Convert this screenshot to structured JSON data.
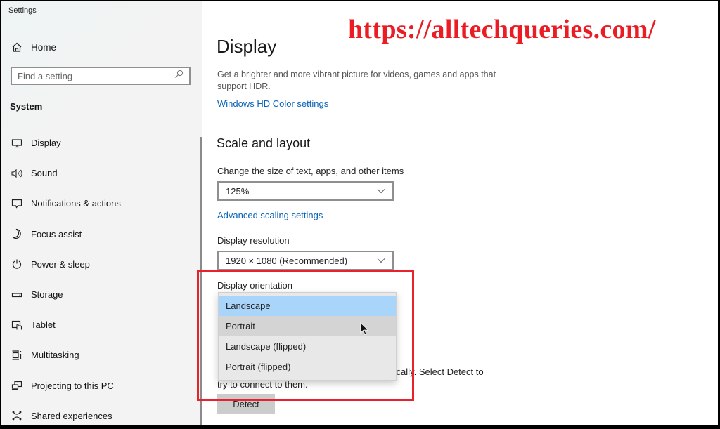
{
  "window": {
    "title": "Settings"
  },
  "sidebar": {
    "home_label": "Home",
    "search_placeholder": "Find a setting",
    "section_label": "System",
    "items": [
      {
        "label": "Display",
        "icon": "monitor-icon"
      },
      {
        "label": "Sound",
        "icon": "speaker-icon"
      },
      {
        "label": "Notifications & actions",
        "icon": "notification-icon"
      },
      {
        "label": "Focus assist",
        "icon": "moon-icon"
      },
      {
        "label": "Power & sleep",
        "icon": "power-icon"
      },
      {
        "label": "Storage",
        "icon": "storage-icon"
      },
      {
        "label": "Tablet",
        "icon": "tablet-icon"
      },
      {
        "label": "Multitasking",
        "icon": "multitasking-icon"
      },
      {
        "label": "Projecting to this PC",
        "icon": "projecting-icon"
      },
      {
        "label": "Shared experiences",
        "icon": "shared-experiences-icon"
      }
    ]
  },
  "main": {
    "title": "Display",
    "hdr_description": "Get a brighter and more vibrant picture for videos, games and apps that support HDR.",
    "hdr_link": "Windows HD Color settings",
    "scale_section_title": "Scale and layout",
    "scale_label": "Change the size of text, apps, and other items",
    "scale_value": "125%",
    "advanced_scaling_link": "Advanced scaling settings",
    "resolution_label": "Display resolution",
    "resolution_value": "1920 × 1080 (Recommended)",
    "orientation_label": "Display orientation",
    "orientation_options": [
      "Landscape",
      "Portrait",
      "Landscape (flipped)",
      "Portrait (flipped)"
    ],
    "orientation_selected": "Landscape",
    "orientation_hovered": "Portrait",
    "detect_text_line1": "matically. Select Detect to",
    "detect_text_line2": "try to connect to them.",
    "detect_button": "Detect"
  },
  "overlay": {
    "watermark": "https://alltechqueries.com/",
    "highlight_color": "#e8212a"
  }
}
